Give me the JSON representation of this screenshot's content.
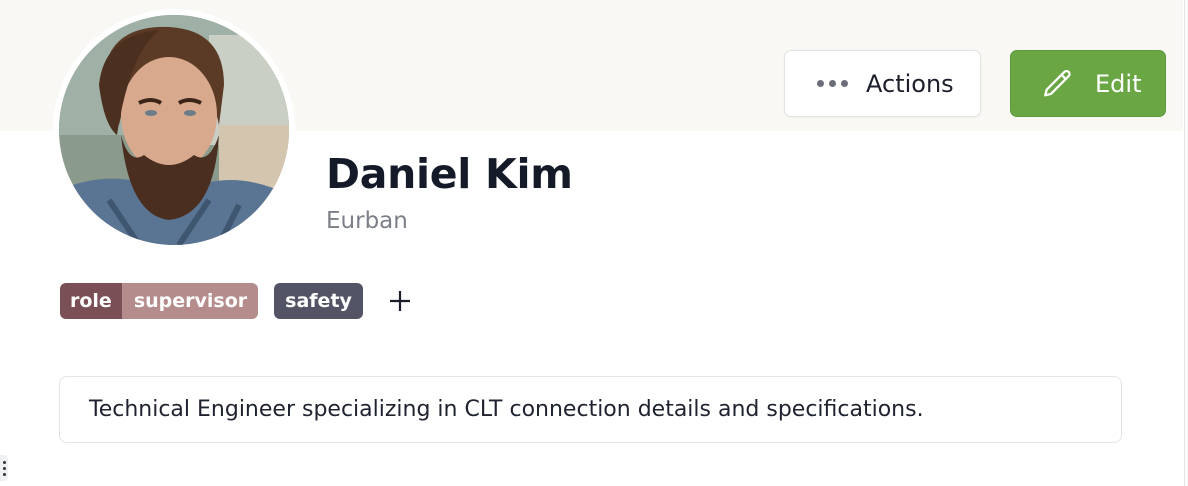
{
  "profile": {
    "name": "Daniel Kim",
    "company": "Eurban",
    "description": "Technical Engineer specializing in CLT connection details and specifications.",
    "avatar_icon": "avatar-photo"
  },
  "toolbar": {
    "actions_label": "Actions",
    "actions_icon": "more-horizontal-icon",
    "edit_label": "Edit",
    "edit_icon": "pencil-icon"
  },
  "tags": {
    "labeled": {
      "key": "role",
      "value": "supervisor"
    },
    "single": "safety",
    "add_icon": "plus-icon"
  },
  "colors": {
    "banner": "#f9f8f4",
    "edit_button": "#6aa744",
    "tag_key": "#7a4f55",
    "tag_value": "#b48c8b",
    "tag_single": "#525466"
  }
}
